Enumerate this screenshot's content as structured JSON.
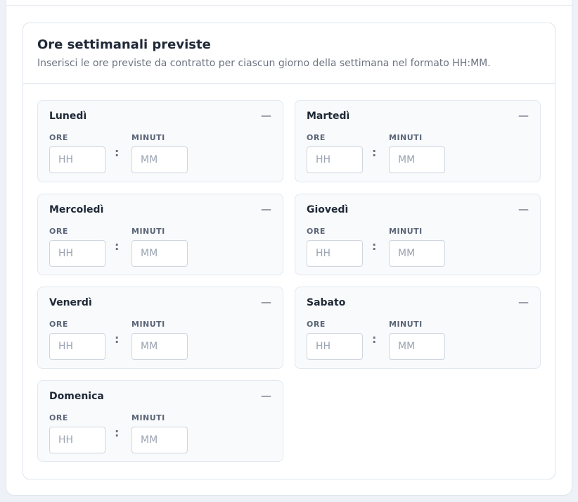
{
  "section": {
    "title": "Ore settimanali previste",
    "description": "Inserisci le ore previste da contratto per ciascun giorno della settimana nel formato HH:MM."
  },
  "labels": {
    "hours": "ORE",
    "minutes": "MINUTI",
    "separator": ":",
    "toggle": "—"
  },
  "placeholders": {
    "hours": "HH",
    "minutes": "MM"
  },
  "days": [
    {
      "name": "Lunedì"
    },
    {
      "name": "Martedì"
    },
    {
      "name": "Mercoledì"
    },
    {
      "name": "Giovedì"
    },
    {
      "name": "Venerdì"
    },
    {
      "name": "Sabato"
    },
    {
      "name": "Domenica"
    }
  ]
}
